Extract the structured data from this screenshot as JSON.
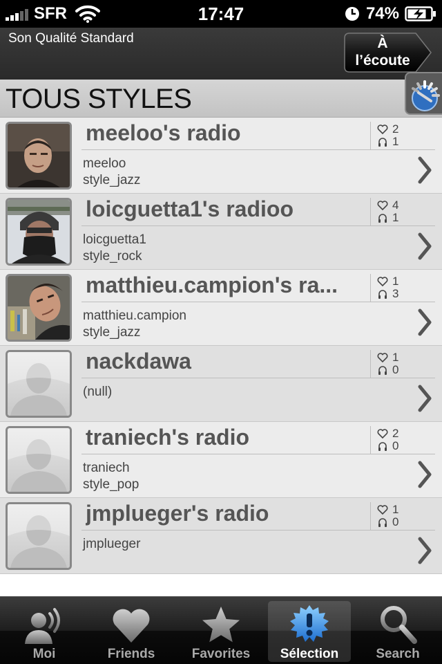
{
  "status_bar": {
    "carrier": "SFR",
    "time": "17:47",
    "battery": "74%"
  },
  "header": {
    "quality": "Son Qualité Standard",
    "listen_line1": "À",
    "listen_line2": "l’écoute"
  },
  "section": {
    "title": "TOUS STYLES"
  },
  "radios": [
    {
      "name": "meeloo's radio",
      "likes": "2",
      "listeners": "1",
      "user": "meeloo",
      "style": "style_jazz"
    },
    {
      "name": "loicguetta1's radioo",
      "likes": "4",
      "listeners": "1",
      "user": "loicguetta1",
      "style": "style_rock"
    },
    {
      "name": "matthieu.campion's ra...",
      "likes": "1",
      "listeners": "3",
      "user": "matthieu.campion",
      "style": "style_jazz"
    },
    {
      "name": "nackdawa",
      "likes": "1",
      "listeners": "0",
      "user": "(null)",
      "style": ""
    },
    {
      "name": "traniech's radio",
      "likes": "2",
      "listeners": "0",
      "user": "traniech",
      "style": "style_pop"
    },
    {
      "name": "jmplueger's radio",
      "likes": "1",
      "listeners": "0",
      "user": "jmplueger",
      "style": ""
    }
  ],
  "tabs": [
    {
      "label": "Moi",
      "icon": "person-sound-icon",
      "active": false
    },
    {
      "label": "Friends",
      "icon": "heart-icon",
      "active": false
    },
    {
      "label": "Favorites",
      "icon": "star-icon",
      "active": false
    },
    {
      "label": "Sélection",
      "icon": "exclamation-badge-icon",
      "active": true
    },
    {
      "label": "Search",
      "icon": "search-icon",
      "active": false
    }
  ],
  "colors": {
    "header_bg": "#2f2f2f",
    "section_bg": "#c8c8c8",
    "row_bg": "#ececec",
    "tab_active": "#ffffff",
    "selection_blue": "#3a8fe0"
  }
}
